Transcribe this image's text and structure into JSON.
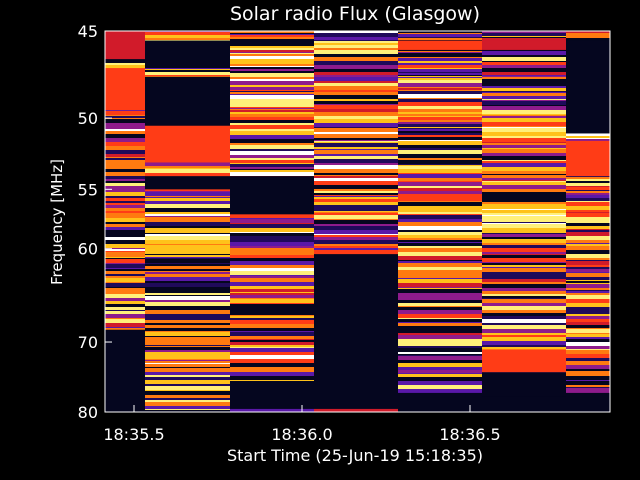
{
  "colors": {
    "background": "#000000",
    "foreground": "#ffffff",
    "palette": [
      "#05061f",
      "#1f0a5a",
      "#5a18a8",
      "#8e1b8c",
      "#d11b2a",
      "#ff3c16",
      "#ff7a10",
      "#ffc21a",
      "#fff07a",
      "#ffffff"
    ]
  },
  "chart_data": {
    "type": "heatmap",
    "title": "Solar radio Flux (Glasgow)",
    "xlabel": "Start Time (25-Jun-19 15:18:35)",
    "ylabel": "Frequency [MHz]",
    "x_tick_labels": [
      "18:35.5",
      "18:36.0",
      "18:36.5"
    ],
    "y_tick_labels": [
      "45",
      "50",
      "55",
      "60",
      "70",
      "80"
    ],
    "ylim": [
      45,
      80
    ],
    "y_scale": "reciprocal",
    "colormap": "black-purple-red-orange-yellow-white",
    "columns": [
      {
        "index": 1,
        "kind": "mixed",
        "seed": 11,
        "bands": [
          [
            45,
            46.5,
            4
          ],
          [
            47,
            49.5,
            5
          ],
          [
            68.5,
            80,
            0
          ]
        ]
      },
      {
        "index": 2,
        "kind": "mixed",
        "seed": 23,
        "bands": [
          [
            45.5,
            47,
            0
          ],
          [
            47.5,
            50.5,
            0
          ],
          [
            50.5,
            53,
            5
          ],
          [
            54,
            55,
            0
          ]
        ]
      },
      {
        "index": 3,
        "kind": "mixed",
        "seed": 37,
        "bands": [
          [
            54,
            57,
            0
          ],
          [
            75.5,
            80,
            0
          ],
          [
            79.5,
            80,
            2
          ]
        ]
      },
      {
        "index": 4,
        "kind": "mixed",
        "seed": 41,
        "bands": [
          [
            60.5,
            80,
            0
          ],
          [
            79.5,
            80,
            4
          ]
        ]
      },
      {
        "index": 5,
        "kind": "mixed",
        "seed": 53,
        "bands": [
          [
            45.5,
            46,
            5
          ],
          [
            77,
            80,
            0
          ]
        ]
      },
      {
        "index": 6,
        "kind": "mixed",
        "seed": 67,
        "bands": [
          [
            45.5,
            46,
            4
          ],
          [
            71,
            74,
            5
          ],
          [
            74,
            77.5,
            0
          ],
          [
            77.5,
            80,
            0
          ]
        ]
      },
      {
        "index": 7,
        "kind": "mixed",
        "seed": 79,
        "bands": [
          [
            45.5,
            51,
            0
          ],
          [
            51.5,
            54,
            5
          ],
          [
            77,
            80,
            0
          ]
        ]
      }
    ]
  }
}
